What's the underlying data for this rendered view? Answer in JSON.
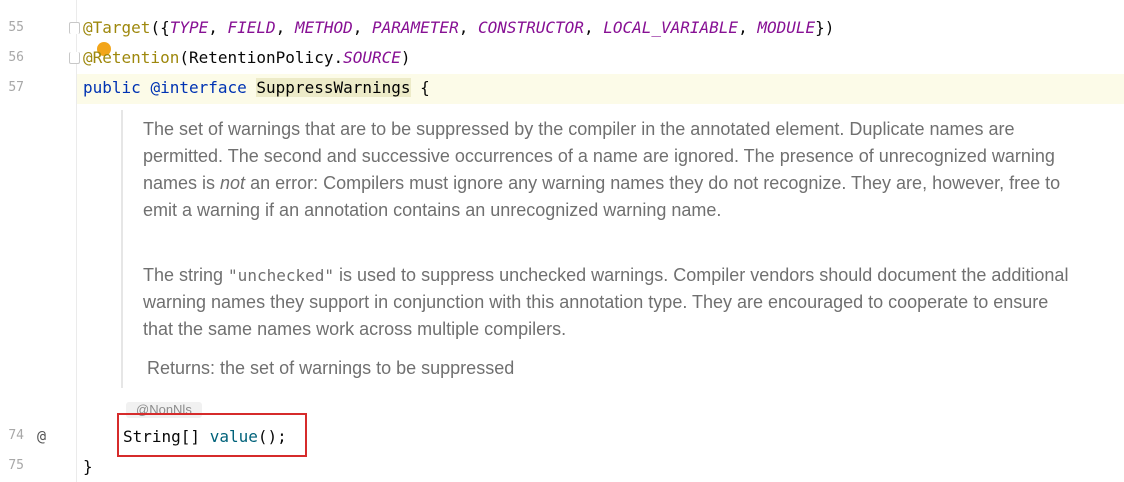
{
  "gutter": {
    "line_55": "55",
    "line_56": "56",
    "line_57": "57",
    "line_74": "74",
    "line_75": "75",
    "at_marker": "@"
  },
  "code": {
    "l55": {
      "at_target": "@Target",
      "open": "({",
      "type": "TYPE",
      "c1": ", ",
      "field": "FIELD",
      "c2": ", ",
      "method": "METHOD",
      "c3": ", ",
      "parameter": "PARAMETER",
      "c4": ", ",
      "constructor": "CONSTRUCTOR",
      "c5": ", ",
      "local_variable": "LOCAL_VARIABLE",
      "c6": ", ",
      "module": "MODULE",
      "close": "})"
    },
    "l56": {
      "at_retention": "@Retention",
      "open": "(RetentionPolicy.",
      "source": "SOURCE",
      "close": ")"
    },
    "l57": {
      "public": "public",
      "sp1": " ",
      "interface": "@interface",
      "sp2": " ",
      "name": "SuppressWarnings",
      "brace": " {"
    },
    "l74": {
      "type": "String[] ",
      "method": "value",
      "rest": "();"
    },
    "l75": {
      "close": "}"
    }
  },
  "doc": {
    "p1_before": "The set of warnings that are to be suppressed by the compiler in the annotated element. Duplicate names are permitted. The second and successive occurrences of a name are ignored. The presence of unrecognized warning names is ",
    "p1_em": "not",
    "p1_after": " an error: Compilers must ignore any warning names they do not recognize. They are, however, free to emit a warning if an annotation contains an unrecognized warning name.",
    "p2_before": "The string ",
    "p2_code": "\"unchecked\"",
    "p2_after": " is used to suppress unchecked warnings. Compiler vendors should document the additional warning names they support in conjunction with this annotation type. They are encouraged to cooperate to ensure that the same names work across multiple compilers.",
    "returns_label": "Returns:",
    "returns_text": " the set of warnings to be suppressed"
  },
  "inlay_hint": "@NonNls",
  "colors": {
    "annotation": "#9e880d",
    "constant": "#871094",
    "keyword": "#0033b3",
    "method": "#00627a",
    "doc_text": "#707070",
    "highlight_box": "#d62b2b"
  }
}
